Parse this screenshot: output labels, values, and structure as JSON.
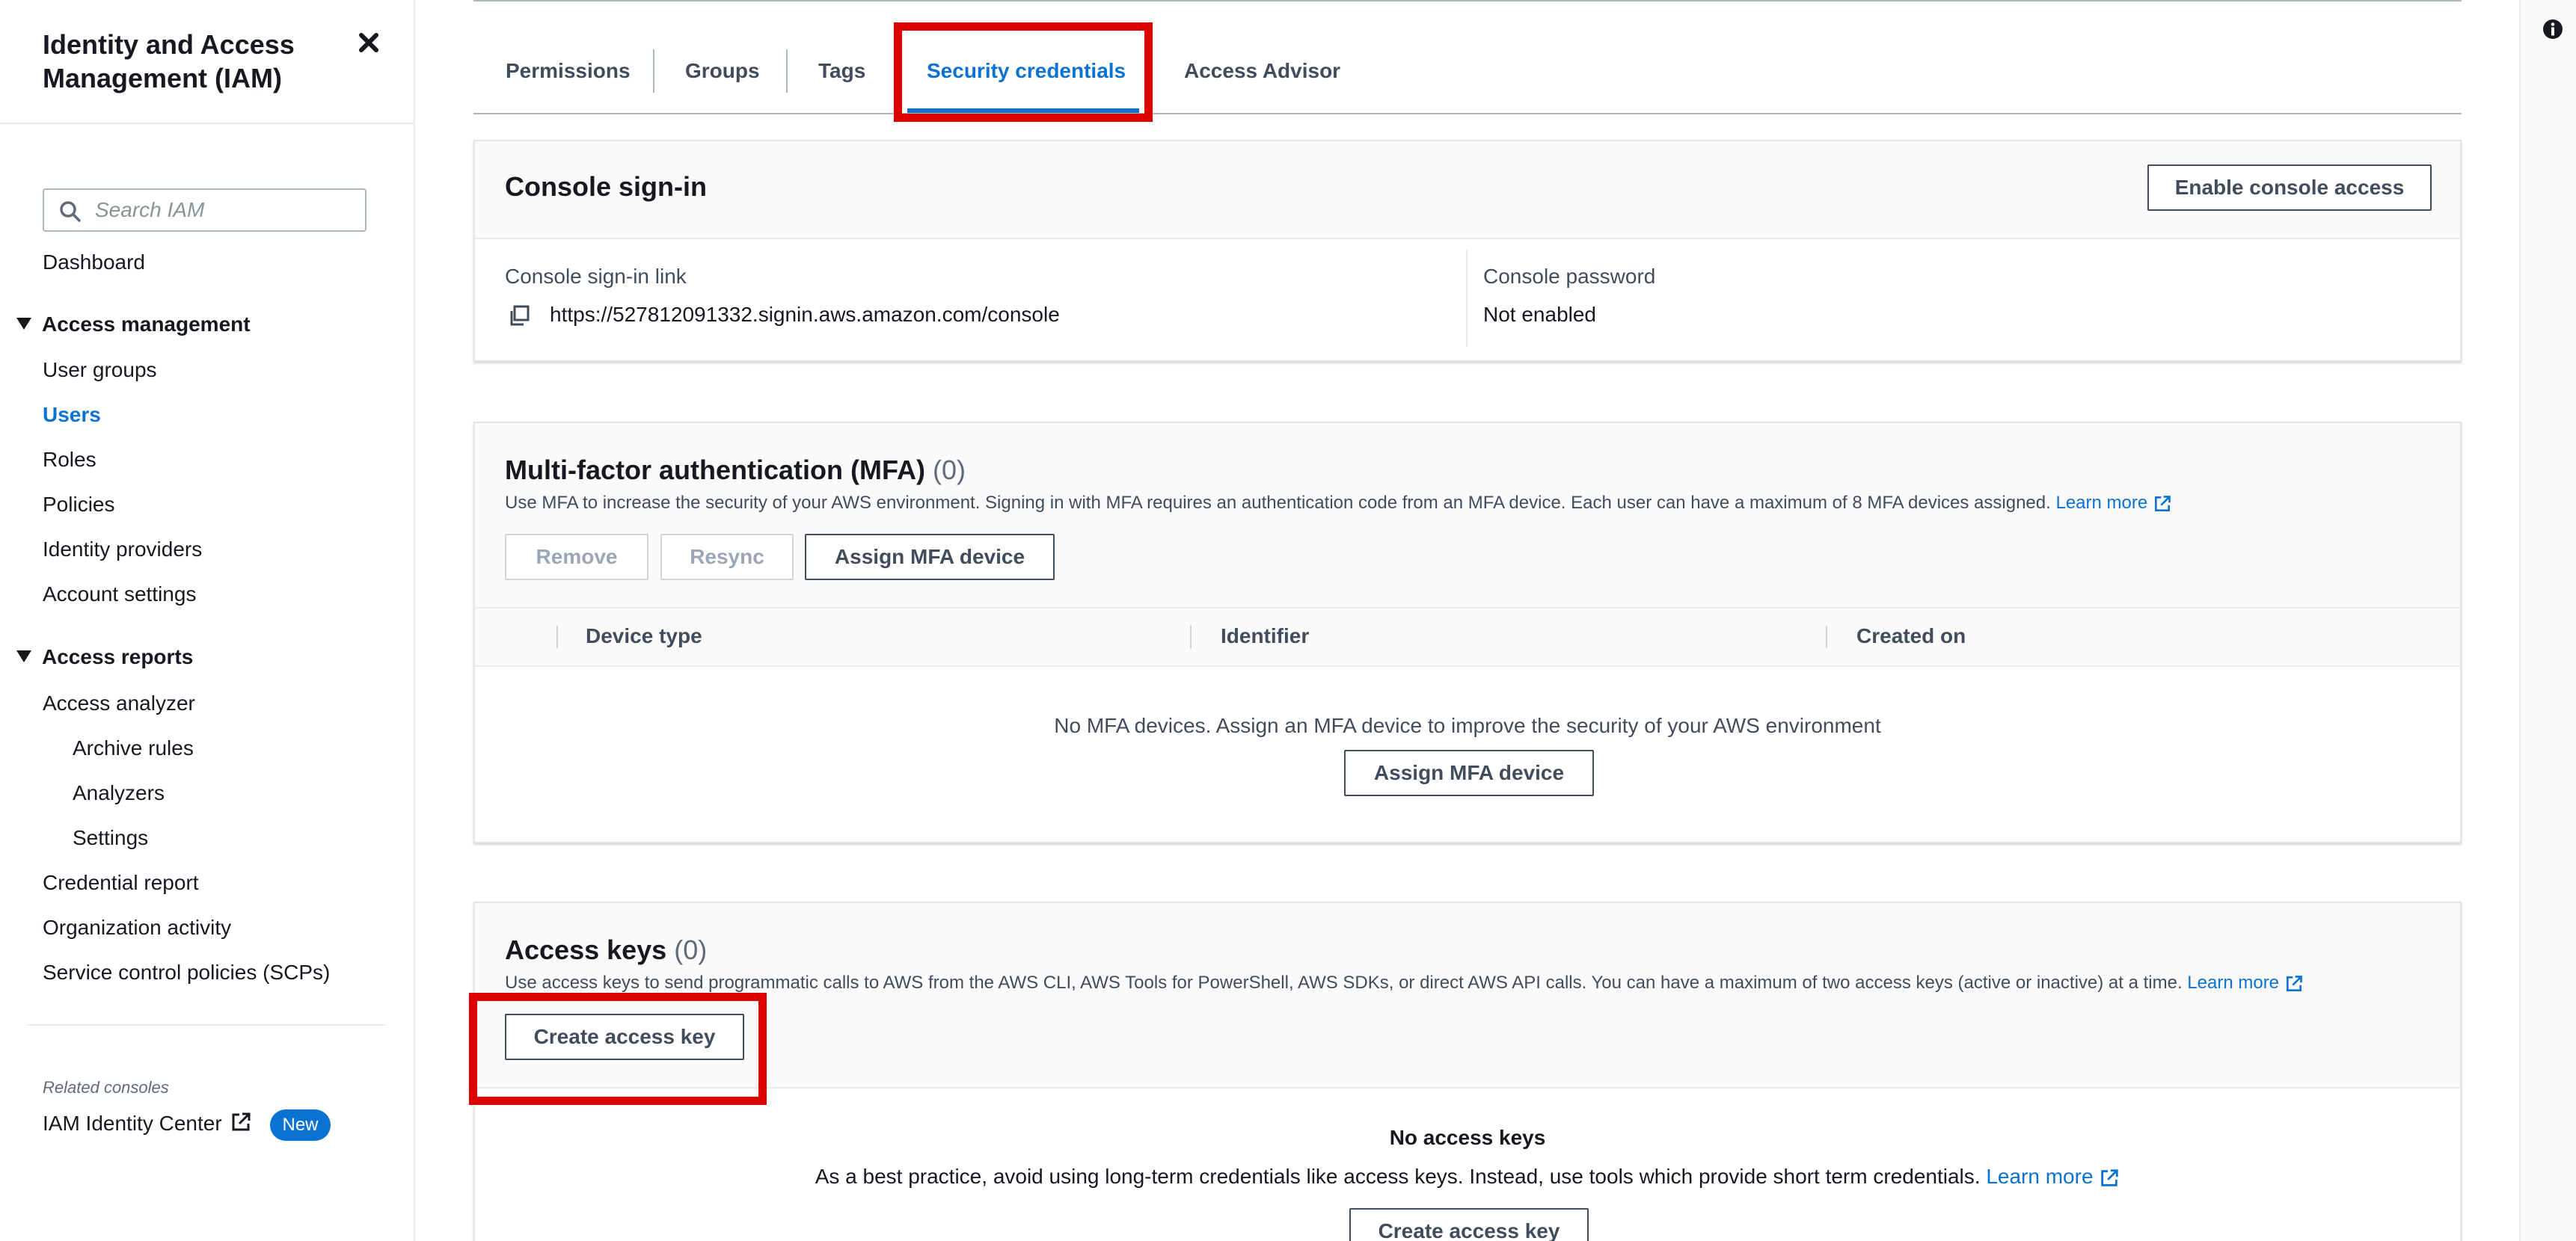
{
  "sidebar": {
    "title": "Identity and Access Management (IAM)",
    "search_placeholder": "Search IAM",
    "dashboard": "Dashboard",
    "sections": [
      {
        "label": "Access management",
        "items": [
          "User groups",
          "Users",
          "Roles",
          "Policies",
          "Identity providers",
          "Account settings"
        ]
      },
      {
        "label": "Access reports",
        "items": [
          "Access analyzer",
          "Archive rules",
          "Analyzers",
          "Settings",
          "Credential report",
          "Organization activity",
          "Service control policies (SCPs)"
        ]
      }
    ],
    "active_item": "Users",
    "related_label": "Related consoles",
    "related_link": "IAM Identity Center",
    "badge": "New"
  },
  "tabs": [
    "Permissions",
    "Groups",
    "Tags",
    "Security credentials",
    "Access Advisor"
  ],
  "active_tab": "Security credentials",
  "console_signin": {
    "title": "Console sign-in",
    "enable_button": "Enable console access",
    "link_label": "Console sign-in link",
    "link_value": "https://527812091332.signin.aws.amazon.com/console",
    "password_label": "Console password",
    "password_value": "Not enabled"
  },
  "mfa": {
    "title": "Multi-factor authentication (MFA)",
    "count": "(0)",
    "description": "Use MFA to increase the security of your AWS environment. Signing in with MFA requires an authentication code from an MFA device. Each user can have a maximum of 8 MFA devices assigned.",
    "learn_more": "Learn more",
    "buttons": {
      "remove": "Remove",
      "resync": "Resync",
      "assign": "Assign MFA device"
    },
    "columns": [
      "Device type",
      "Identifier",
      "Created on"
    ],
    "empty_text": "No MFA devices. Assign an MFA device to improve the security of your AWS environment",
    "empty_button": "Assign MFA device"
  },
  "access_keys": {
    "title": "Access keys",
    "count": "(0)",
    "description": "Use access keys to send programmatic calls to AWS from the AWS CLI, AWS Tools for PowerShell, AWS SDKs, or direct AWS API calls. You can have a maximum of two access keys (active or inactive) at a time.",
    "learn_more": "Learn more",
    "create_button": "Create access key",
    "empty_title": "No access keys",
    "empty_text": "As a best practice, avoid using long-term credentials like access keys. Instead, use tools which provide short term credentials.",
    "empty_learn_more": "Learn more",
    "empty_button": "Create access key"
  },
  "colors": {
    "accent": "#0972d3",
    "highlight": "#dd0000",
    "text": "#16191f",
    "muted": "#414d5c"
  }
}
